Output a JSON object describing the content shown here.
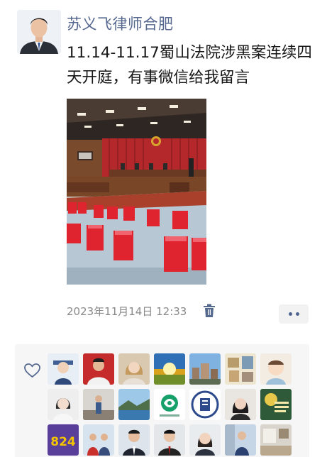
{
  "post": {
    "author": "苏义飞律师合肥",
    "text": "11.14-11.17蜀山法院涉黑案连续四天开庭，有事微信给我留言",
    "time": "2023年11月14日 12:33",
    "image": {
      "subject": "courtroom-with-red-stools"
    }
  },
  "actions": {
    "delete_icon": "trash-icon",
    "more_icon": "more-dots-icon"
  },
  "likes": {
    "icon": "heart-outline-icon",
    "avatars": [
      {
        "icon": "avatar-cartoon-lawyer",
        "tile_text": ""
      },
      {
        "icon": "avatar-man-red-bg",
        "tile_text": ""
      },
      {
        "icon": "avatar-woman-portrait",
        "tile_text": ""
      },
      {
        "icon": "avatar-sunrise-landscape",
        "tile_text": ""
      },
      {
        "icon": "avatar-city-buildings",
        "tile_text": ""
      },
      {
        "icon": "avatar-photo-wall",
        "tile_text": ""
      },
      {
        "icon": "avatar-cartoon-baby",
        "tile_text": ""
      },
      {
        "icon": "avatar-woman-pale",
        "tile_text": ""
      },
      {
        "icon": "avatar-man-blue-shirt",
        "tile_text": ""
      },
      {
        "icon": "avatar-sea-landscape",
        "tile_text": ""
      },
      {
        "icon": "avatar-green-logo",
        "tile_text": ""
      },
      {
        "icon": "avatar-court-emblem",
        "tile_text": ""
      },
      {
        "icon": "avatar-woman-dark-hair",
        "tile_text": ""
      },
      {
        "icon": "avatar-green-poster",
        "tile_text": ""
      },
      {
        "icon": "avatar-purple-824",
        "tile_text": "824"
      },
      {
        "icon": "avatar-man-group",
        "tile_text": ""
      },
      {
        "icon": "avatar-man-suit",
        "tile_text": ""
      },
      {
        "icon": "avatar-man-red-tie",
        "tile_text": ""
      },
      {
        "icon": "avatar-woman-suit",
        "tile_text": ""
      },
      {
        "icon": "avatar-man-office",
        "tile_text": ""
      },
      {
        "icon": "avatar-room-interior",
        "tile_text": ""
      }
    ]
  },
  "colors": {
    "author": "#56688f",
    "meta": "#8a8a8a",
    "likes_bg": "#f6f6f7",
    "accent": "#4f6590"
  }
}
